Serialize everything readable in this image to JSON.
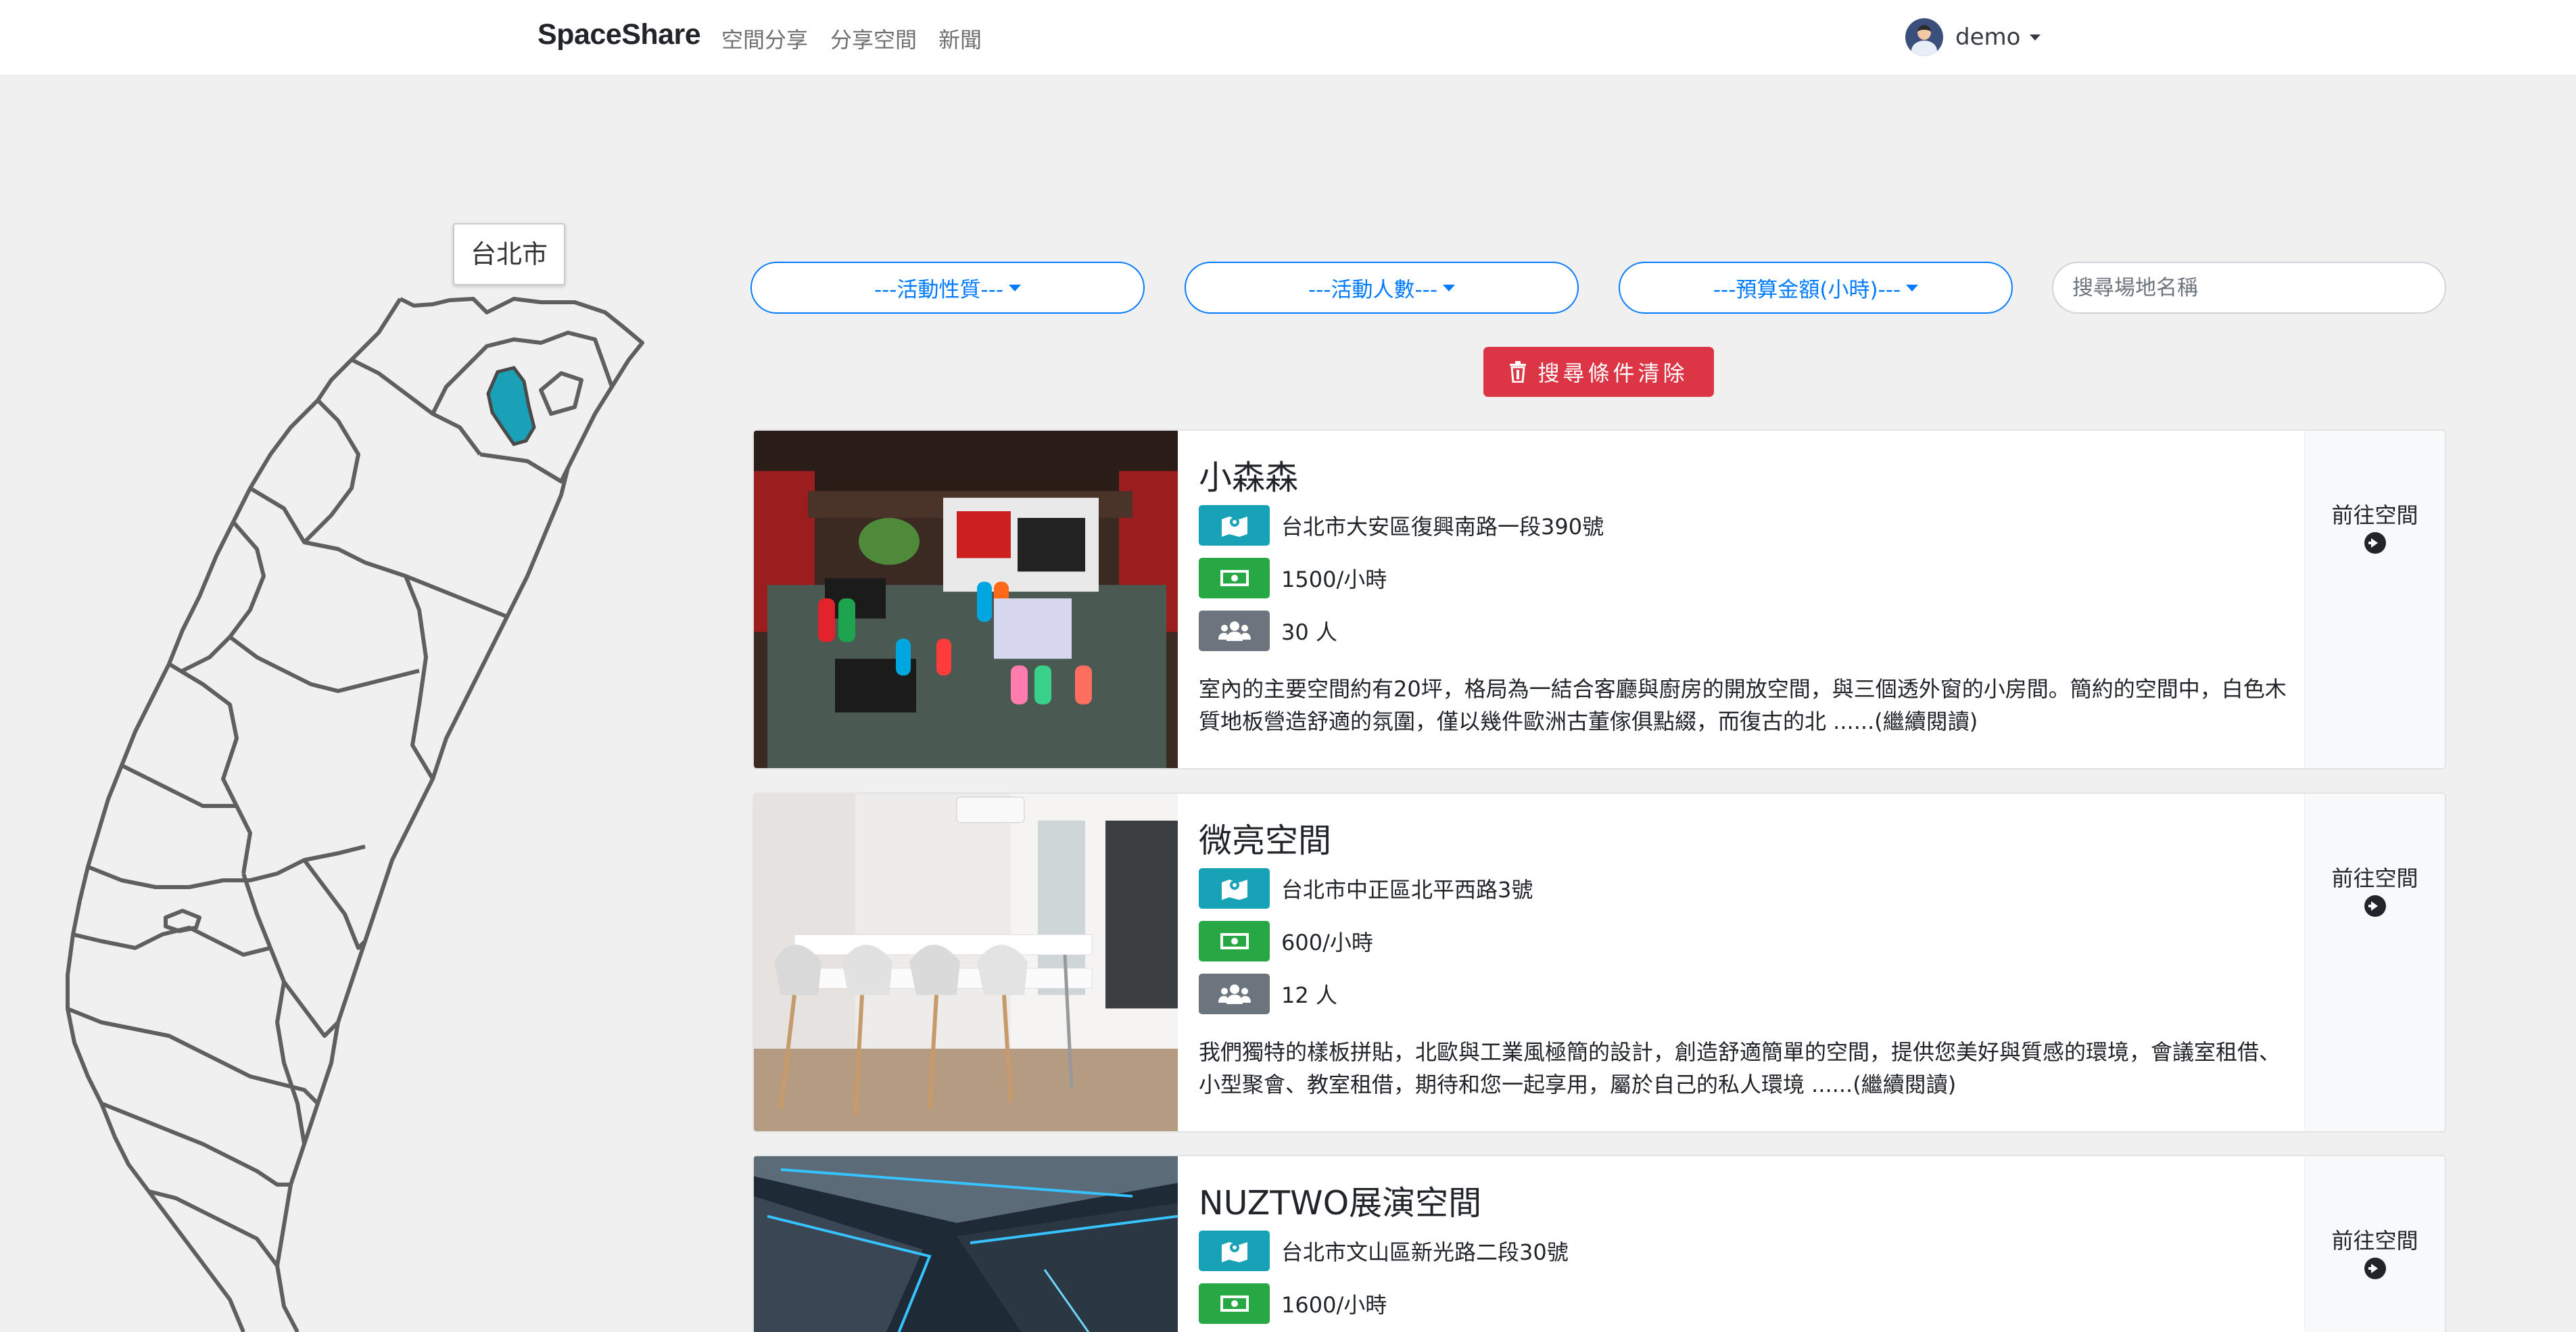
{
  "navbar": {
    "brand": "SpaceShare",
    "links": [
      "空間分享",
      "分享空間",
      "新聞"
    ],
    "user": "demo"
  },
  "map": {
    "tooltip": "台北市",
    "highlight_color": "#1aa0b7"
  },
  "filters": {
    "activity_type": "---活動性質---",
    "headcount": "---活動人數---",
    "budget": "---預算金額(小時)---",
    "search_placeholder": "搜尋場地名稱",
    "clear_label": "搜尋條件清除"
  },
  "spaces": [
    {
      "name": "小森森",
      "address": "台北市大安區復興南路一段390號",
      "price": "1500/小時",
      "capacity": "30 人",
      "desc_line1": "室內的主要空間約有20坪，格局為一結合客廳與廚房的開放空間，與三個透外窗的小房間。簡約的空間中，白色木",
      "desc_line2": "質地板營造舒適的氛圍，僅以幾件歐洲古董傢俱點綴，而復古的北 ......(繼續閱讀)",
      "goto": "前往空間"
    },
    {
      "name": "微亮空間",
      "address": "台北市中正區北平西路3號",
      "price": "600/小時",
      "capacity": "12 人",
      "desc_line1": "我們獨特的樣板拼貼，北歐與工業風極簡的設計，創造舒適簡單的空間，提供您美好與質感的環境，會議室租借、",
      "desc_line2": "小型聚會、教室租借，期待和您一起享用，屬於自己的私人環境 ......(繼續閱讀)",
      "goto": "前往空間"
    },
    {
      "name": "NUZTWO展演空間",
      "address": "台北市文山區新光路二段30號",
      "price": "1600/小時",
      "capacity": "",
      "desc_line1": "",
      "desc_line2": "",
      "goto": "前往空間"
    }
  ],
  "colors": {
    "primary": "#007bff",
    "danger": "#dc3545",
    "info": "#17a2b8",
    "success": "#28a745",
    "secondary": "#6c757d"
  },
  "icons": [
    "map-marked-icon",
    "money-bill-icon",
    "users-icon",
    "arrow-circle-right-icon",
    "trash-icon",
    "user-avatar"
  ]
}
